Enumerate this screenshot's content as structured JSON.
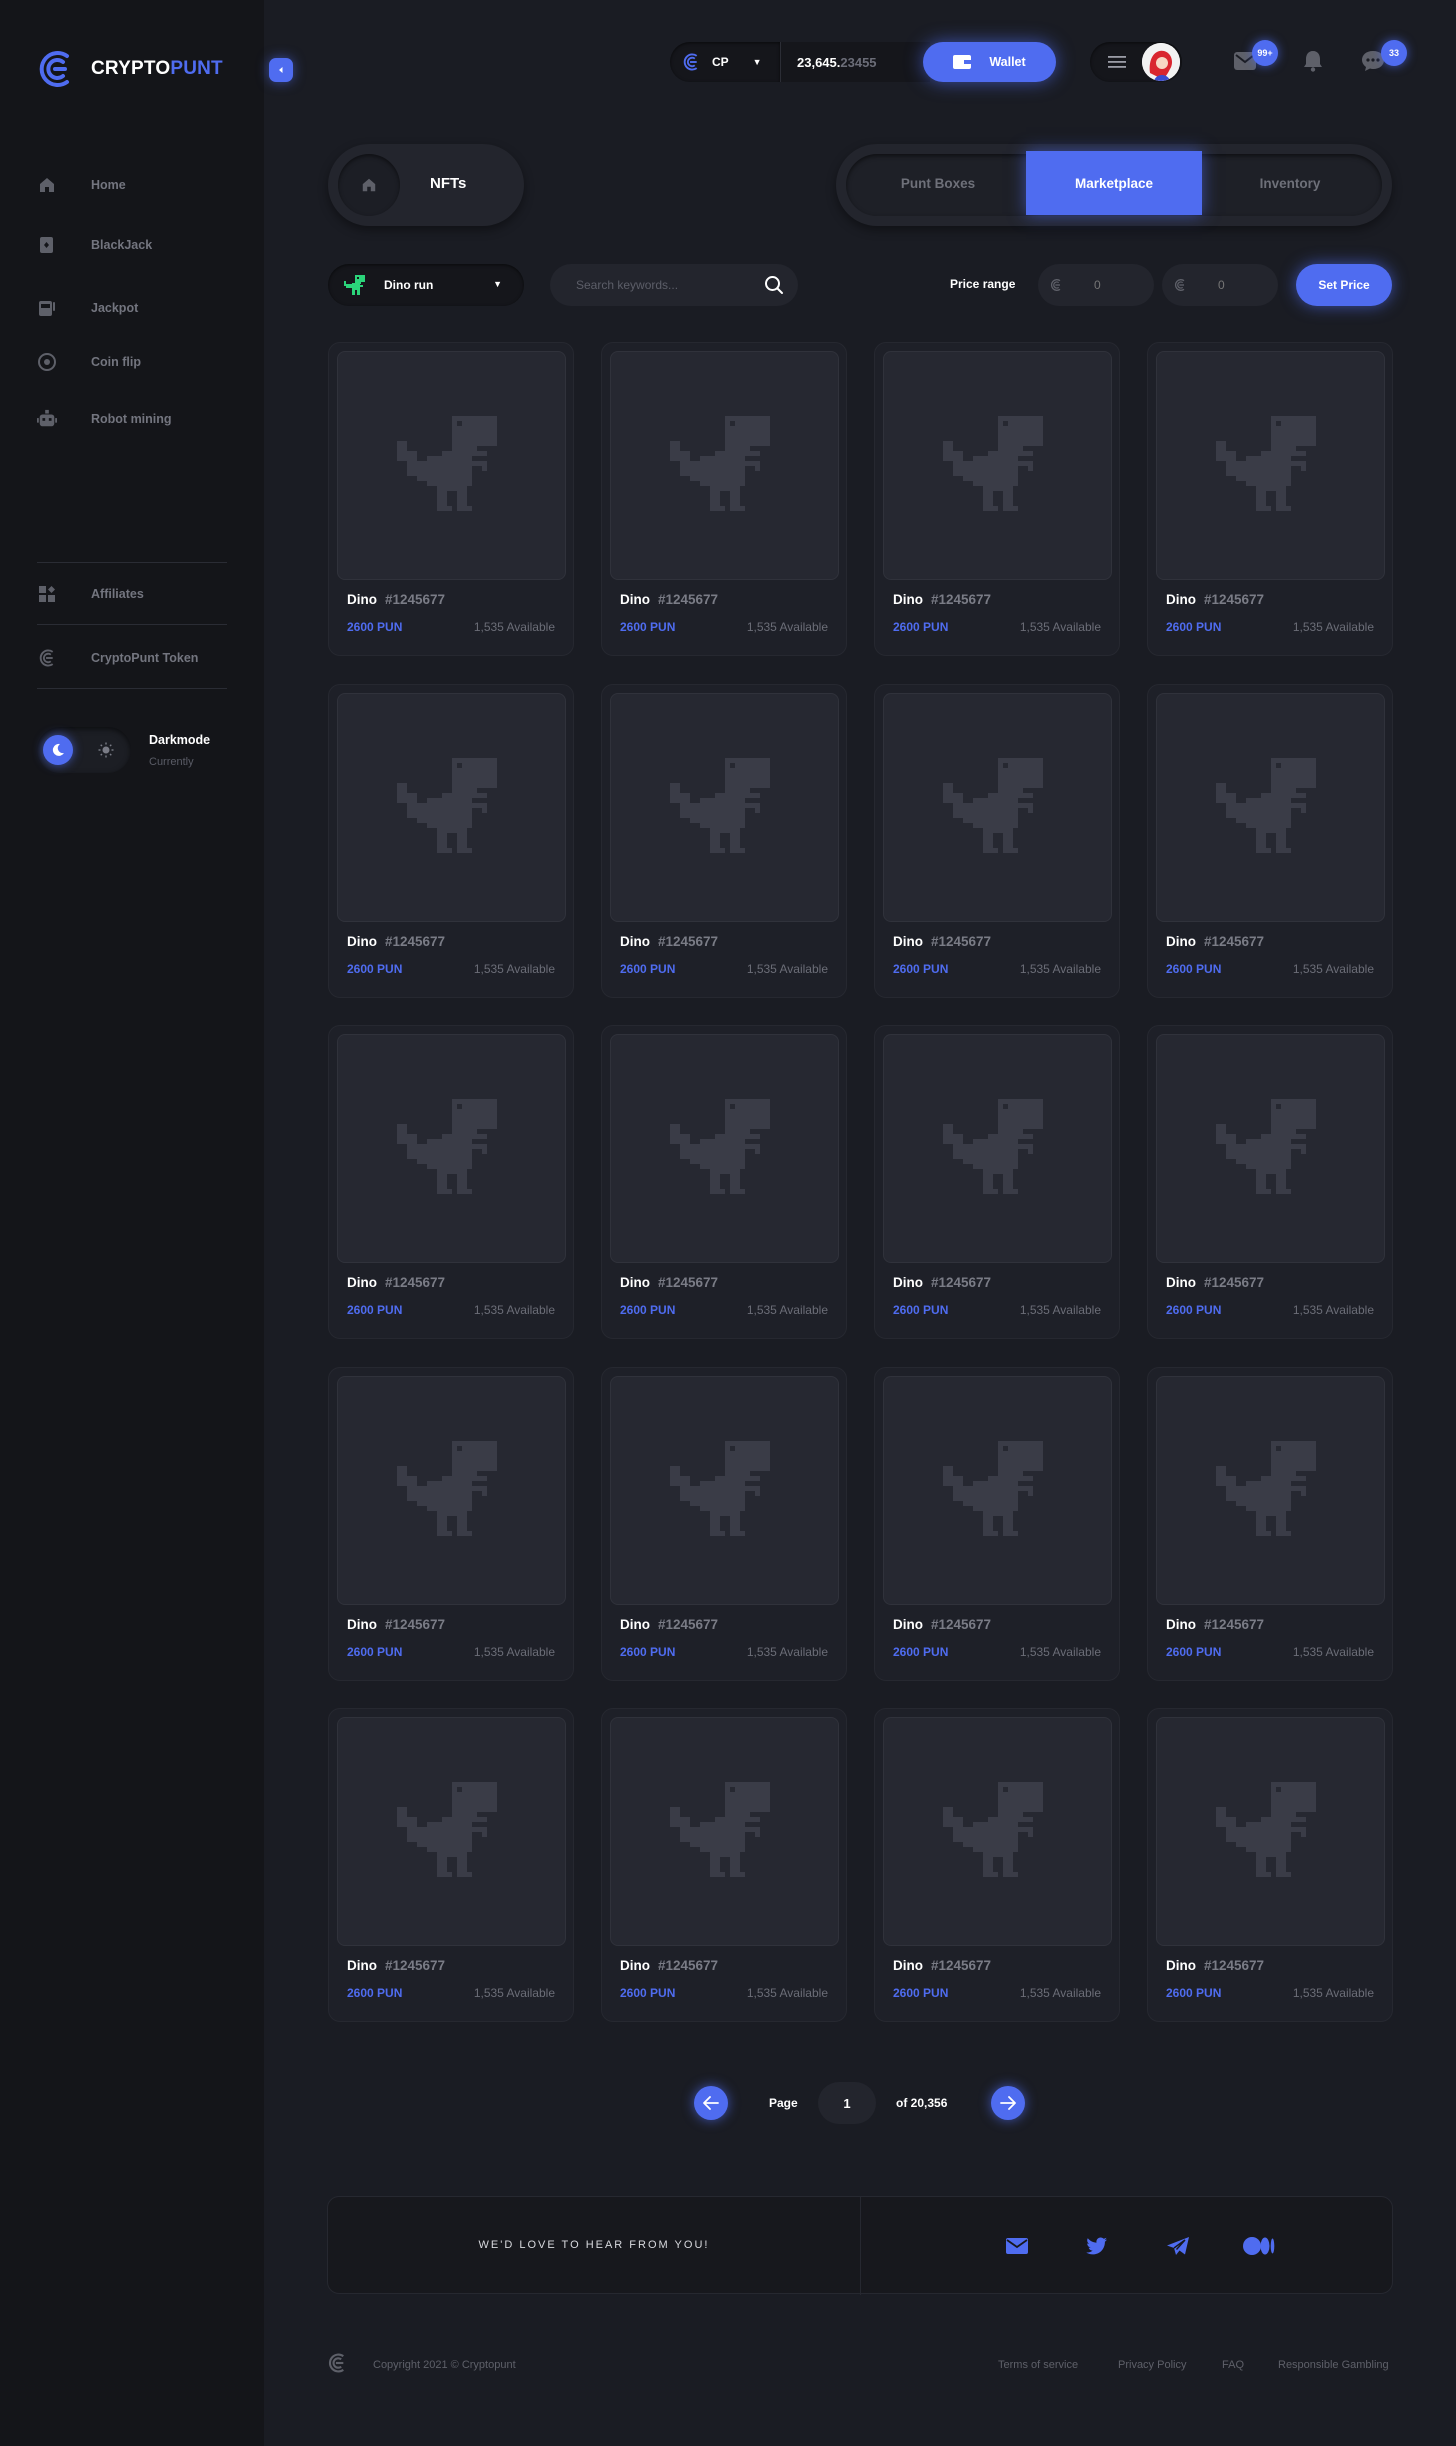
{
  "brand": {
    "part1": "CRYPTO",
    "part2": "PUNT"
  },
  "sidebar": {
    "items": [
      {
        "label": "Home"
      },
      {
        "label": "BlackJack"
      },
      {
        "label": "Jackpot"
      },
      {
        "label": "Coin flip"
      },
      {
        "label": "Robot mining"
      }
    ],
    "secondary": [
      {
        "label": "Affiliates"
      },
      {
        "label": "CryptoPunt Token"
      }
    ],
    "darkmode": {
      "title": "Darkmode",
      "subtitle": "Currently"
    }
  },
  "header": {
    "currency": "CP",
    "balance_int": "23,645.",
    "balance_dec": "23455",
    "wallet_label": "Wallet",
    "mail_badge": "99+",
    "chat_badge": "33"
  },
  "nav": {
    "crumb": "NFTs",
    "tabs": [
      {
        "label": "Punt Boxes",
        "active": false
      },
      {
        "label": "Marketplace",
        "active": true
      },
      {
        "label": "Inventory",
        "active": false
      }
    ]
  },
  "filters": {
    "collection": "Dino run",
    "search_placeholder": "Search keywords...",
    "price_label": "Price range",
    "price_min": "0",
    "price_max": "0",
    "set_price_label": "Set Price"
  },
  "card": {
    "name": "Dino",
    "id": "#1245677",
    "price": "2600 PUN",
    "available": "1,535 Available"
  },
  "pagination": {
    "page_label": "Page",
    "current": "1",
    "of_label": "of 20,356"
  },
  "contact": {
    "message": "WE'D LOVE TO HEAR FROM YOU!"
  },
  "footer": {
    "copyright": "Copyright 2021 © Cryptopunt",
    "links": [
      "Terms of service",
      "Privacy Policy",
      "FAQ",
      "Responsible Gambling"
    ]
  },
  "colors": {
    "accent": "#4f6cf0",
    "background": "#1a1c23",
    "sidebar": "#141519",
    "card": "#1e2028"
  }
}
